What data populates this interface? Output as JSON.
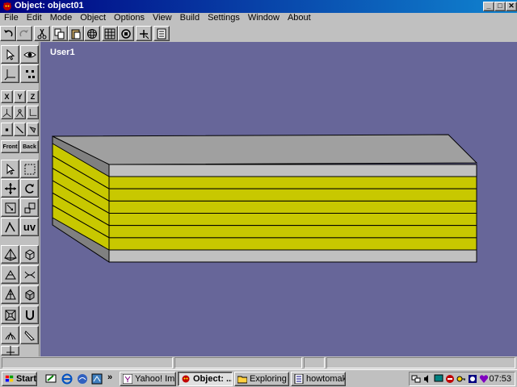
{
  "window": {
    "title": "Object: object01"
  },
  "menu": [
    "File",
    "Edit",
    "Mode",
    "Object",
    "Options",
    "View",
    "Build",
    "Settings",
    "Window",
    "About"
  ],
  "left_panel": {
    "axis_x": "X",
    "axis_y": "Y",
    "axis_z": "Z",
    "front": "Front",
    "back": "Back",
    "uv": "uv"
  },
  "viewport": {
    "label": "User1",
    "background": "#676699"
  },
  "model": {
    "top_color": "#a0a0a0",
    "side_color": "#808080",
    "stripe_color": "#c8c800",
    "band_color": "#c0c0c0",
    "stripe_count": 6
  },
  "taskbar": {
    "start": "Start",
    "tasks": [
      "Yahoo! Im...",
      "Object: ...",
      "Exploring -...",
      "howtomak..."
    ],
    "clock": "07:53",
    "quicklaunch_overflow": "»"
  },
  "icons": {
    "app": "devil-icon",
    "undo": "undo-icon",
    "redo": "redo-icon",
    "cut": "scissors-icon"
  }
}
